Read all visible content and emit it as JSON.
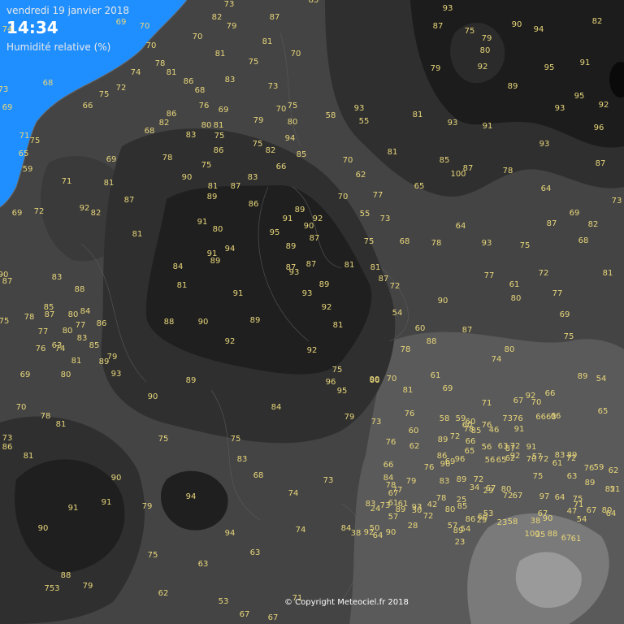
{
  "header": {
    "date": "vendredi 19 janvier 2018",
    "time": "14:34",
    "parameter": "Humidité relative (%)"
  },
  "copyright": "© Copyright Meteociel.fr 2018",
  "colors": {
    "sea": "#1f8fff",
    "land_base": "#444444",
    "humid_zone": "#2f2f2f",
    "very_humid_zone": "#1f1f1f",
    "dry_zone": "#5a5a5a",
    "driest_zone": "#9a9a9a",
    "value_text": "#e8d67a",
    "header_text": "#e8e8e8"
  },
  "stations": [
    {
      "v": "73"
    },
    {
      "v": "85"
    },
    {
      "v": "82"
    },
    {
      "v": "87"
    },
    {
      "v": "79"
    },
    {
      "v": "69"
    },
    {
      "v": "70"
    },
    {
      "v": "74"
    },
    {
      "v": "70"
    },
    {
      "v": "81"
    },
    {
      "v": "70"
    },
    {
      "v": "81"
    },
    {
      "v": "78"
    },
    {
      "v": "74"
    },
    {
      "v": "81"
    },
    {
      "v": "86"
    },
    {
      "v": "75"
    },
    {
      "v": "83"
    },
    {
      "v": "72"
    },
    {
      "v": "73"
    },
    {
      "v": "68"
    },
    {
      "v": "68"
    },
    {
      "v": "69"
    },
    {
      "v": "66"
    },
    {
      "v": "75"
    },
    {
      "v": "70"
    },
    {
      "v": "73"
    },
    {
      "v": "76"
    },
    {
      "v": "69"
    },
    {
      "v": "70"
    },
    {
      "v": "75"
    },
    {
      "v": "86"
    },
    {
      "v": "68"
    },
    {
      "v": "82"
    },
    {
      "v": "80"
    },
    {
      "v": "81"
    },
    {
      "v": "79"
    },
    {
      "v": "80"
    },
    {
      "v": "83"
    },
    {
      "v": "75"
    },
    {
      "v": "94"
    },
    {
      "v": "71"
    },
    {
      "v": "75"
    },
    {
      "v": "86"
    },
    {
      "v": "75"
    },
    {
      "v": "82"
    },
    {
      "v": "65"
    },
    {
      "v": "78"
    },
    {
      "v": "85"
    },
    {
      "v": "59"
    },
    {
      "v": "69"
    },
    {
      "v": "75"
    },
    {
      "v": "66"
    },
    {
      "v": "90"
    },
    {
      "v": "83"
    },
    {
      "v": "71"
    },
    {
      "v": "81"
    },
    {
      "v": "81"
    },
    {
      "v": "87"
    },
    {
      "v": "89"
    },
    {
      "v": "86"
    },
    {
      "v": "92"
    },
    {
      "v": "82"
    },
    {
      "v": "87"
    },
    {
      "v": "69"
    },
    {
      "v": "72"
    },
    {
      "v": "91"
    },
    {
      "v": "80"
    },
    {
      "v": "89"
    },
    {
      "v": "92"
    },
    {
      "v": "91"
    },
    {
      "v": "90"
    },
    {
      "v": "95"
    },
    {
      "v": "87"
    },
    {
      "v": "81"
    },
    {
      "v": "94"
    },
    {
      "v": "89"
    },
    {
      "v": "91"
    },
    {
      "v": "89"
    },
    {
      "v": "84"
    },
    {
      "v": "87"
    },
    {
      "v": "93"
    },
    {
      "v": "87"
    },
    {
      "v": "81"
    },
    {
      "v": "90"
    },
    {
      "v": "87"
    },
    {
      "v": "83"
    },
    {
      "v": "88"
    },
    {
      "v": "81"
    },
    {
      "v": "89"
    },
    {
      "v": "85"
    },
    {
      "v": "87"
    },
    {
      "v": "93"
    },
    {
      "v": "91"
    },
    {
      "v": "80"
    },
    {
      "v": "84"
    },
    {
      "v": "92"
    },
    {
      "v": "78"
    },
    {
      "v": "77"
    },
    {
      "v": "75"
    },
    {
      "v": "88"
    },
    {
      "v": "90"
    },
    {
      "v": "89"
    },
    {
      "v": "81"
    },
    {
      "v": "77"
    },
    {
      "v": "80"
    },
    {
      "v": "86"
    },
    {
      "v": "76"
    },
    {
      "v": "63"
    },
    {
      "v": "83"
    },
    {
      "v": "74"
    },
    {
      "v": "85"
    },
    {
      "v": "92"
    },
    {
      "v": "81"
    },
    {
      "v": "79"
    },
    {
      "v": "89"
    },
    {
      "v": "80"
    },
    {
      "v": "93"
    },
    {
      "v": "69"
    },
    {
      "v": "92"
    },
    {
      "v": "75"
    },
    {
      "v": "96"
    },
    {
      "v": "95"
    },
    {
      "v": "90"
    },
    {
      "v": "89"
    },
    {
      "v": "90"
    },
    {
      "v": "70"
    },
    {
      "v": "78"
    },
    {
      "v": "81"
    },
    {
      "v": "84"
    },
    {
      "v": "79"
    },
    {
      "v": "73"
    },
    {
      "v": "75"
    },
    {
      "v": "73"
    },
    {
      "v": "75"
    },
    {
      "v": "86"
    },
    {
      "v": "81"
    },
    {
      "v": "83"
    },
    {
      "v": "68"
    },
    {
      "v": "90"
    },
    {
      "v": "90"
    },
    {
      "v": "91"
    },
    {
      "v": "79"
    },
    {
      "v": "94"
    },
    {
      "v": "91"
    },
    {
      "v": "74"
    },
    {
      "v": "73"
    },
    {
      "v": "94"
    },
    {
      "v": "74"
    },
    {
      "v": "75"
    },
    {
      "v": "63"
    },
    {
      "v": "63"
    },
    {
      "v": "88"
    },
    {
      "v": "79"
    },
    {
      "v": "753"
    },
    {
      "v": "62"
    },
    {
      "v": "53"
    },
    {
      "v": "67"
    },
    {
      "v": "67"
    },
    {
      "v": "71"
    },
    {
      "v": "93"
    },
    {
      "v": "87"
    },
    {
      "v": "75"
    },
    {
      "v": "79"
    },
    {
      "v": "90"
    },
    {
      "v": "94"
    },
    {
      "v": "82"
    },
    {
      "v": "80"
    },
    {
      "v": "79"
    },
    {
      "v": "92"
    },
    {
      "v": "95"
    },
    {
      "v": "91"
    },
    {
      "v": "81"
    },
    {
      "v": "93"
    },
    {
      "v": "89"
    },
    {
      "v": "91"
    },
    {
      "v": "93"
    },
    {
      "v": "95"
    },
    {
      "v": "92"
    },
    {
      "v": "96"
    },
    {
      "v": "85"
    },
    {
      "v": "93"
    },
    {
      "v": "87"
    },
    {
      "v": "100"
    },
    {
      "v": "87"
    },
    {
      "v": "78"
    },
    {
      "v": "81"
    },
    {
      "v": "93"
    },
    {
      "v": "55"
    },
    {
      "v": "58"
    },
    {
      "v": "70"
    },
    {
      "v": "62"
    },
    {
      "v": "65"
    },
    {
      "v": "64"
    },
    {
      "v": "70"
    },
    {
      "v": "77"
    },
    {
      "v": "73"
    },
    {
      "v": "55"
    },
    {
      "v": "64"
    },
    {
      "v": "73"
    },
    {
      "v": "69"
    },
    {
      "v": "87"
    },
    {
      "v": "82"
    },
    {
      "v": "75"
    },
    {
      "v": "93"
    },
    {
      "v": "75"
    },
    {
      "v": "68"
    },
    {
      "v": "68"
    },
    {
      "v": "78"
    },
    {
      "v": "77"
    },
    {
      "v": "81"
    },
    {
      "v": "87"
    },
    {
      "v": "72"
    },
    {
      "v": "61"
    },
    {
      "v": "72"
    },
    {
      "v": "81"
    },
    {
      "v": "90"
    },
    {
      "v": "80"
    },
    {
      "v": "77"
    },
    {
      "v": "54"
    },
    {
      "v": "69"
    },
    {
      "v": "60"
    },
    {
      "v": "87"
    },
    {
      "v": "75"
    },
    {
      "v": "78"
    },
    {
      "v": "88"
    },
    {
      "v": "80"
    },
    {
      "v": "74"
    },
    {
      "v": "89"
    },
    {
      "v": "54"
    },
    {
      "v": "61"
    },
    {
      "v": "69"
    },
    {
      "v": "66"
    },
    {
      "v": "70"
    },
    {
      "v": "81"
    },
    {
      "v": "71"
    },
    {
      "v": "67"
    },
    {
      "v": "92"
    },
    {
      "v": "70"
    },
    {
      "v": "66"
    },
    {
      "v": "6663"
    },
    {
      "v": "76"
    },
    {
      "v": "58"
    },
    {
      "v": "59"
    },
    {
      "v": "60"
    },
    {
      "v": "7376"
    },
    {
      "v": "91"
    },
    {
      "v": "66"
    },
    {
      "v": "65"
    },
    {
      "v": "60"
    },
    {
      "v": "89"
    },
    {
      "v": "72"
    },
    {
      "v": "60"
    },
    {
      "v": "76"
    },
    {
      "v": "78"
    },
    {
      "v": "85"
    },
    {
      "v": "56"
    },
    {
      "v": "76"
    },
    {
      "v": "62"
    },
    {
      "v": "63"
    },
    {
      "v": "72"
    },
    {
      "v": "86"
    },
    {
      "v": "65"
    },
    {
      "v": "66"
    },
    {
      "v": "46"
    },
    {
      "v": "87"
    },
    {
      "v": "62"
    },
    {
      "v": "92"
    },
    {
      "v": "70"
    },
    {
      "v": "61"
    },
    {
      "v": "66"
    },
    {
      "v": "76"
    },
    {
      "v": "69"
    },
    {
      "v": "90"
    },
    {
      "v": "96"
    },
    {
      "v": "56"
    },
    {
      "v": "65"
    },
    {
      "v": "91"
    },
    {
      "v": "57"
    },
    {
      "v": "72"
    },
    {
      "v": "75"
    },
    {
      "v": "72"
    },
    {
      "v": "83"
    },
    {
      "v": "89"
    },
    {
      "v": "63"
    },
    {
      "v": "76"
    },
    {
      "v": "59"
    },
    {
      "v": "62"
    },
    {
      "v": "89"
    },
    {
      "v": "51"
    },
    {
      "v": "84"
    },
    {
      "v": "78"
    },
    {
      "v": "67"
    },
    {
      "v": "79"
    },
    {
      "v": "83"
    },
    {
      "v": "89"
    },
    {
      "v": "72"
    },
    {
      "v": "29"
    },
    {
      "v": "80"
    },
    {
      "v": "72"
    },
    {
      "v": "77"
    },
    {
      "v": "73"
    },
    {
      "v": "61"
    },
    {
      "v": "83"
    },
    {
      "v": "93"
    },
    {
      "v": "78"
    },
    {
      "v": "25"
    },
    {
      "v": "34"
    },
    {
      "v": "67"
    },
    {
      "v": "67"
    },
    {
      "v": "24"
    },
    {
      "v": "61"
    },
    {
      "v": "89"
    },
    {
      "v": "80"
    },
    {
      "v": "85"
    },
    {
      "v": "60"
    },
    {
      "v": "53"
    },
    {
      "v": "42"
    },
    {
      "v": "30"
    },
    {
      "v": "67"
    },
    {
      "v": "97"
    },
    {
      "v": "64"
    },
    {
      "v": "75"
    },
    {
      "v": "71"
    },
    {
      "v": "67"
    },
    {
      "v": "80"
    },
    {
      "v": "64"
    },
    {
      "v": "82"
    },
    {
      "v": "47"
    },
    {
      "v": "54"
    },
    {
      "v": "38"
    },
    {
      "v": "35"
    },
    {
      "v": "57"
    },
    {
      "v": "72"
    },
    {
      "v": "57"
    },
    {
      "v": "86"
    },
    {
      "v": "28"
    },
    {
      "v": "54"
    },
    {
      "v": "29"
    },
    {
      "v": "90"
    },
    {
      "v": "92"
    },
    {
      "v": "90"
    },
    {
      "v": "89"
    },
    {
      "v": "23"
    },
    {
      "v": "58"
    },
    {
      "v": "100"
    },
    {
      "v": "88"
    },
    {
      "v": "67"
    },
    {
      "v": "61"
    },
    {
      "v": "23"
    },
    {
      "v": "84"
    },
    {
      "v": "38"
    },
    {
      "v": "50"
    },
    {
      "v": "64"
    }
  ]
}
